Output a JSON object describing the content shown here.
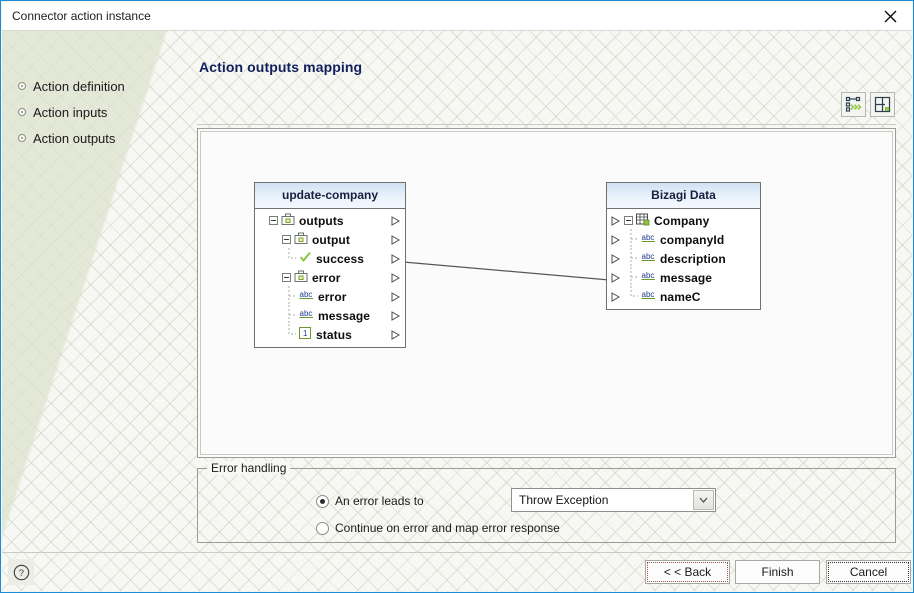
{
  "window": {
    "title": "Connector action instance",
    "close_icon": "close-icon"
  },
  "sidebar": {
    "items": [
      {
        "label": "Action definition"
      },
      {
        "label": "Action inputs"
      },
      {
        "label": "Action outputs"
      }
    ]
  },
  "main": {
    "page_title": "Action outputs mapping",
    "toolbar": {
      "buttons": [
        {
          "name": "auto-map-button",
          "icon": "auto-map-icon"
        },
        {
          "name": "layout-button",
          "icon": "layout-grid-icon"
        }
      ]
    }
  },
  "mapping": {
    "source": {
      "title": "update-company",
      "rows": [
        {
          "label": "outputs",
          "indent": 0,
          "icon": "folder-output-icon",
          "expander": "minus",
          "tree": "none",
          "arrow": "output-arrow"
        },
        {
          "label": "output",
          "indent": 1,
          "icon": "folder-output-icon",
          "expander": "minus",
          "tree": "none",
          "arrow": "output-arrow"
        },
        {
          "label": "success",
          "indent": 2,
          "icon": "boolean-check-icon",
          "expander": "none",
          "tree": "last",
          "arrow": "output-arrow"
        },
        {
          "label": "error",
          "indent": 1,
          "icon": "folder-output-icon",
          "expander": "minus",
          "tree": "none",
          "arrow": "output-arrow"
        },
        {
          "label": "error",
          "indent": 2,
          "icon": "abc-string-icon",
          "expander": "none",
          "tree": "branch",
          "arrow": "output-arrow"
        },
        {
          "label": "message",
          "indent": 2,
          "icon": "abc-string-icon",
          "expander": "none",
          "tree": "branch",
          "arrow": "output-arrow"
        },
        {
          "label": "status",
          "indent": 2,
          "icon": "number-one-icon",
          "expander": "none",
          "tree": "last",
          "arrow": "output-arrow"
        }
      ]
    },
    "target": {
      "title": "Bizagi Data",
      "rows": [
        {
          "label": "Company",
          "indent": 0,
          "icon": "entity-table-icon",
          "expander": "minus",
          "tree": "none",
          "arrow": "input-arrow"
        },
        {
          "label": "companyId",
          "indent": 1,
          "icon": "abc-string-icon",
          "expander": "none",
          "tree": "branch",
          "arrow": "input-arrow"
        },
        {
          "label": "description",
          "indent": 1,
          "icon": "abc-string-icon",
          "expander": "none",
          "tree": "branch",
          "arrow": "input-arrow"
        },
        {
          "label": "message",
          "indent": 1,
          "icon": "abc-string-icon",
          "expander": "none",
          "tree": "branch",
          "arrow": "input-arrow"
        },
        {
          "label": "nameC",
          "indent": 1,
          "icon": "abc-string-icon",
          "expander": "none",
          "tree": "last",
          "arrow": "input-arrow"
        }
      ]
    },
    "connections": [
      {
        "from": "success",
        "to": "message"
      }
    ]
  },
  "error_handling": {
    "legend": "Error handling",
    "options": [
      {
        "label": "An error leads to",
        "selected": true
      },
      {
        "label": "Continue on error and map error response",
        "selected": false
      }
    ],
    "select": {
      "value": "Throw Exception",
      "options": [
        "Throw Exception"
      ]
    }
  },
  "footer": {
    "help_icon": "help-question-icon",
    "buttons": [
      {
        "name": "back-button",
        "label": "< < Back"
      },
      {
        "name": "finish-button",
        "label": "Finish"
      },
      {
        "name": "cancel-button",
        "label": "Cancel"
      }
    ]
  },
  "colors": {
    "window_border": "#1a8cd8",
    "title_text": "#11205c",
    "node_header": "#cfe1f4",
    "link_line": "#55585a"
  }
}
